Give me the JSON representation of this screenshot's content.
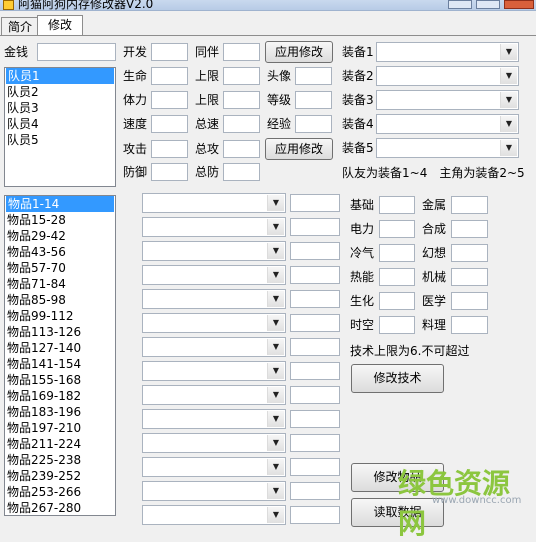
{
  "window": {
    "title": "阿猫阿狗内存修改器V2.0"
  },
  "tabs": [
    {
      "label": "简介"
    },
    {
      "label": "修改"
    }
  ],
  "gold": {
    "label": "金钱",
    "value": ""
  },
  "members": [
    "队员1",
    "队员2",
    "队员3",
    "队员4",
    "队员5"
  ],
  "stats": {
    "col1": [
      "开发",
      "生命",
      "体力",
      "速度",
      "攻击",
      "防御"
    ],
    "col2": [
      "同伴",
      "上限",
      "上限",
      "总速",
      "总攻",
      "总防"
    ],
    "col3": [
      "头像",
      "等级",
      "经验"
    ],
    "apply_label": "应用修改"
  },
  "equipment": {
    "labels": [
      "装备1",
      "装备2",
      "装备3",
      "装备4",
      "装备5"
    ],
    "note": "队友为装备1~4　主角为装备2~5"
  },
  "items": [
    "物品1-14",
    "物品15-28",
    "物品29-42",
    "物品43-56",
    "物品57-70",
    "物品71-84",
    "物品85-98",
    "物品99-112",
    "物品113-126",
    "物品127-140",
    "物品141-154",
    "物品155-168",
    "物品169-182",
    "物品183-196",
    "物品197-210",
    "物品211-224",
    "物品225-238",
    "物品239-252",
    "物品253-266",
    "物品267-280"
  ],
  "tech": {
    "labels": [
      [
        "基础",
        "金属"
      ],
      [
        "电力",
        "合成"
      ],
      [
        "冷气",
        "幻想"
      ],
      [
        "热能",
        "机械"
      ],
      [
        "生化",
        "医学"
      ],
      [
        "时空",
        "料理"
      ]
    ],
    "limit_note": "技术上限为6.不可超过",
    "modify_label": "修改技术"
  },
  "buttons": {
    "modify_items": "修改物品",
    "read_data": "读取数据"
  },
  "watermark": {
    "main": "绿色资源网",
    "sub": "www.downcc.com"
  }
}
